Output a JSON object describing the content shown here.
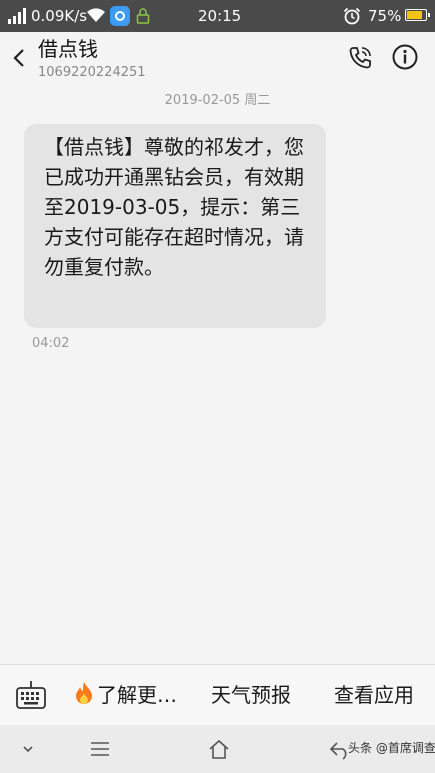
{
  "status_bar": {
    "net_speed": "0.09K/s",
    "time": "20:15",
    "battery": "75%",
    "battery_color": "#f1c40f",
    "icons": [
      "signal-icon",
      "wifi-icon",
      "app-icon",
      "lock-icon",
      "alarm-icon",
      "battery-icon"
    ]
  },
  "header": {
    "contact_name": "借点钱",
    "contact_number": "1069220224251",
    "back_icon": "chevron-left-icon",
    "call_icon": "phone-call-icon",
    "info_icon": "info-icon"
  },
  "conversation": {
    "date": "2019-02-05 周二",
    "messages": [
      {
        "text": "【借点钱】尊敬的祁发才，您已成功开通黑钻会员，有效期至2019-03-05，提示：第三方支付可能存在超时情况，请勿重复付款。",
        "time": "04:02"
      }
    ]
  },
  "quick_replies": {
    "keyboard_icon": "keyboard-icon",
    "items": [
      {
        "label": "了解更…",
        "icon": "fire-icon"
      },
      {
        "label": "天气预报"
      },
      {
        "label": "查看应用"
      }
    ]
  },
  "nav_bar": {
    "icons": [
      "chevron-down-icon",
      "menu-icon",
      "home-icon",
      "back-arrow-icon"
    ],
    "watermark": "头条 @首席调查官"
  }
}
